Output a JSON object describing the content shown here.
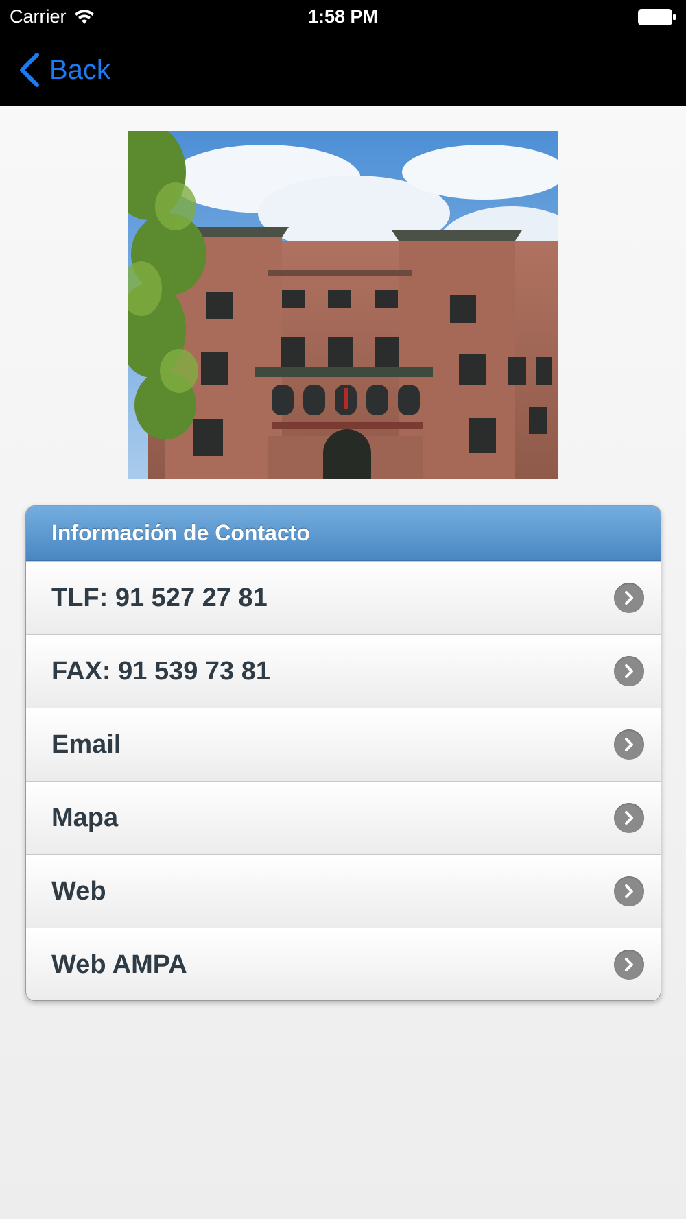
{
  "status_bar": {
    "carrier": "Carrier",
    "time": "1:58 PM"
  },
  "nav": {
    "back_label": "Back"
  },
  "photo": {
    "icon": "school-building-photo"
  },
  "contact": {
    "header": "Información de Contacto",
    "items": [
      {
        "label": "TLF: 91 527 27 81"
      },
      {
        "label": "FAX: 91 539 73 81"
      },
      {
        "label": "Email"
      },
      {
        "label": "Mapa"
      },
      {
        "label": "Web"
      },
      {
        "label": "Web AMPA"
      }
    ]
  },
  "colors": {
    "accent": "#1a7cf5",
    "header_top": "#74aee0",
    "header_bottom": "#4a86c1",
    "row_text": "#2f3b45"
  }
}
